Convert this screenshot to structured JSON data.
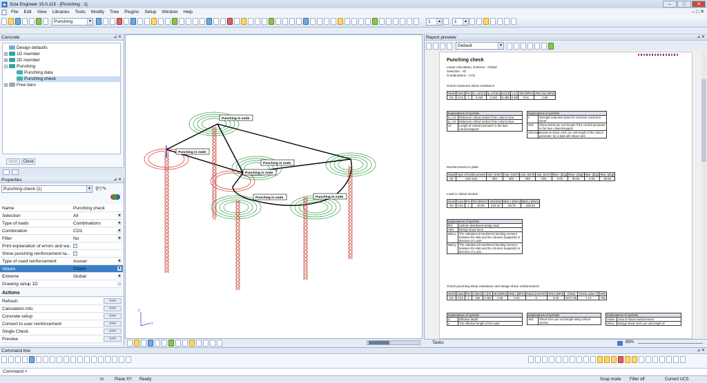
{
  "app": {
    "title": "Scia Engineer 15.0.115 - [Punching : 1]"
  },
  "menu": [
    "File",
    "Edit",
    "View",
    "Libraries",
    "Tools",
    "Modify",
    "Tree",
    "Plugins",
    "Setup",
    "Window",
    "Help"
  ],
  "toolbar": {
    "combo_value": "Punching",
    "spin1": "1",
    "spin2": "1"
  },
  "concrete_panel": {
    "title": "Concrete",
    "tree": [
      {
        "label": "Design defaults",
        "level": 1,
        "icon": "design-defaults-icon"
      },
      {
        "label": "1D member",
        "level": 1,
        "icon": "member-1d-icon"
      },
      {
        "label": "2D member",
        "level": 1,
        "icon": "member-2d-icon"
      },
      {
        "label": "Punching",
        "level": 1,
        "icon": "punching-icon"
      },
      {
        "label": "Punching data",
        "level": 2,
        "icon": "punching-data-icon"
      },
      {
        "label": "Punching check",
        "level": 2,
        "icon": "punching-check-icon"
      },
      {
        "label": "Free bars",
        "level": 1,
        "icon": "free-bars-icon"
      }
    ],
    "new_label": "New",
    "close_label": "Close"
  },
  "properties": {
    "title": "Properties",
    "selector": "Punching check (1)",
    "rows": [
      {
        "k": "Name",
        "v": "Punching check",
        "type": "text"
      },
      {
        "k": "Selection",
        "v": "All",
        "type": "dropdown"
      },
      {
        "k": "Type of loads",
        "v": "Combinations",
        "type": "dropdown"
      },
      {
        "k": "Combination",
        "v": "CO1",
        "type": "dropdown"
      },
      {
        "k": "Filter",
        "v": "No",
        "type": "dropdown"
      },
      {
        "k": "Print explanation of errors and wa...",
        "v": "",
        "type": "check"
      },
      {
        "k": "Show punching reinforcement ta...",
        "v": "",
        "type": "check"
      },
      {
        "k": "Type of used reinforcement",
        "v": "Asuser",
        "type": "dropdown"
      },
      {
        "k": "Values",
        "v": "Check",
        "type": "dropdown"
      },
      {
        "k": "Extreme",
        "v": "Global",
        "type": "dropdown"
      },
      {
        "k": "Drawing setup 1D",
        "v": "",
        "type": "more"
      }
    ]
  },
  "actions": {
    "title": "Actions",
    "items": [
      "Refresh",
      "Calculation info",
      "Concrete setup",
      "Convert to user reinforcement",
      "Single Check",
      "Preview"
    ],
    "go": ">>>"
  },
  "view": {
    "node_label": "Punching in node"
  },
  "report": {
    "title": "Report preview",
    "style": "Default",
    "heading": "Punching check",
    "meta": [
      "Linear calculation,  Extreme : Global",
      "Selection : All",
      "Combinations : CO1"
    ],
    "sec1": "Check maximum shear resistance",
    "t1_head": [
      "Node",
      "Case",
      "Per.",
      "lx_col [m]",
      "ly_col [m]",
      "c0 [m]",
      "ν [-]",
      "vRd [MPa]",
      "vRd,max [MPa]"
    ],
    "t1_row": [
      "N2",
      "CO1",
      "1",
      "0.320",
      "0.320",
      "0.480",
      "0.55",
      "8.01",
      "2.84"
    ],
    "expl_title": "Explanations of symbols",
    "e1": [
      [
        "lx_col",
        "Distances critical section from column face."
      ],
      [
        "ly_col",
        "Distances critical section from column face."
      ],
      [
        "c0",
        "Length of control perimeter in the face column/support"
      ]
    ],
    "e2": [
      [
        "ν",
        "Strength reduction factor for concrete cracked in shear"
      ],
      [
        "vRd",
        "Shear stress per unit length of the control perimeter in the face column/support"
      ],
      [
        "vRd,max",
        "Maximum shear reinf. per unit length of the critical perimeter, for a slab with shear reinf."
      ]
    ],
    "sec2": "Reinforcement in plate",
    "t2_head": [
      "Node",
      "Type of reinforcement",
      "Asx+ [mm²]",
      "Asy+ [mm²]",
      "Asx- [mm²]",
      "Asy- [mm²]",
      "Φsx+ [deg]",
      "Φsy+ [deg]",
      "Φsx- [deg]",
      "Φsy- [deg]"
    ],
    "t2_row": [
      "N2",
      "User real",
      "393",
      "393",
      "393",
      "393",
      "0.00",
      "90.00",
      "0.00",
      "90.00"
    ],
    "sec3": "Load in critical section",
    "t3_head": [
      "Node",
      "Case",
      "Per.",
      "fEd [kN/m²]",
      "VEd [kN]",
      "MEd,x [kNm]",
      "MEd,y [kNm]"
    ],
    "t3_row": [
      "N2",
      "CO1",
      "1",
      "-10.00",
      "410.15",
      "-49.78",
      "-220.50"
    ],
    "e3": [
      [
        "fEd",
        "Uniform distributed design load"
      ],
      [
        "VEd",
        "Design shear force"
      ],
      [
        "MEd,x",
        "The unbalanced transferred bending moment between the slab and the columns (supports) in direction of x axis"
      ],
      [
        "MEd,y",
        "The unbalanced transferred bending moment between the slab and the columns (supports) in direction of y axis"
      ]
    ],
    "sec4": "Check punching shear resistance and design shear reinforcement",
    "t4_head": [
      "Node",
      "Case",
      "Per.",
      "d [mm]",
      "u [m]",
      "vEd [MPa]",
      "vRd,c [MPa]",
      "Asw/u [mm²/m]",
      "vRd,s [MPa]",
      "Check",
      "Check value [-]",
      "W/E"
    ],
    "t4_row": [
      "N2",
      "CO1",
      "1",
      "180",
      "1.462",
      "2.59",
      "0.44",
      "0",
      "0.00",
      "NOT OK",
      "1.72",
      "785"
    ],
    "e4a": [
      [
        "d",
        "effective depth."
      ],
      [
        "u",
        "The effective length of the outer"
      ]
    ],
    "e4b": [
      [
        "vEd",
        "Shear force per unit length along critical section"
      ]
    ],
    "e4c": [
      [
        "Asw/u",
        "Area of shear reinforcement"
      ],
      [
        "vRd,s",
        "Design shear reinf. per unit length of"
      ]
    ]
  },
  "tasks": {
    "label": "Tasks",
    "zoom": "89%"
  },
  "command": {
    "title": "Command line",
    "prompt": "Command >"
  },
  "status": {
    "units": "m",
    "plane": "Plane XY",
    "state": "Ready",
    "snap": "Snap mode",
    "filter": "Filter off",
    "ucs": "Current UCS"
  }
}
